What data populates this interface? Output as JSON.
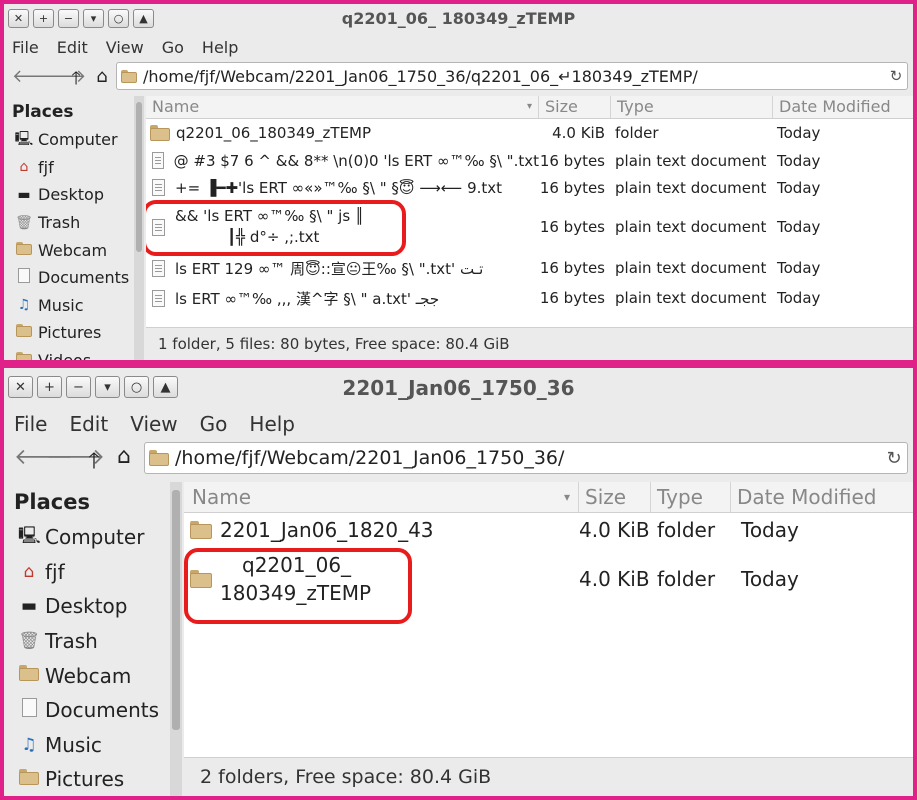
{
  "window1": {
    "title": "q2201_06_ 180349_zTEMP",
    "window_buttons": [
      "✕",
      "+",
      "−",
      "▾",
      "○",
      "▲"
    ],
    "menu": [
      "File",
      "Edit",
      "View",
      "Go",
      "Help"
    ],
    "path": "/home/fjf/Webcam/2201_Jan06_1750_36/q2201_06_↵180349_zTEMP/",
    "sidebar": {
      "heading": "Places",
      "items": [
        "Computer",
        "fjf",
        "Desktop",
        "Trash",
        "Webcam",
        "Documents",
        "Music",
        "Pictures",
        "Videos"
      ]
    },
    "columns": {
      "name": "Name",
      "size": "Size",
      "type": "Type",
      "modified": "Date Modified"
    },
    "rows": [
      {
        "name": "q2201_06_180349_zTEMP",
        "size": "4.0 KiB",
        "type": "folder",
        "modified": "Today",
        "icon": "folder-icon"
      },
      {
        "name": "@ #3 $7 6 ^ && 8** \\n(0)0 'ls ERT ∞™‰ §\\ \".txt",
        "size": "16 bytes",
        "type": "plain text document",
        "modified": "Today",
        "icon": "document-icon"
      },
      {
        "name": "+= ▐━✚'ls ERT ∞«»™‰ §\\ \" §😇 ⟶⟵ 9.txt",
        "size": "16 bytes",
        "type": "plain text document",
        "modified": "Today",
        "icon": "document-icon"
      },
      {
        "name": "&& 'ls ERT ∞™‰ §\\ \" js ║",
        "name_line2": "┃╬ d°÷ ,;.txt",
        "size": "16 bytes",
        "type": "plain text document",
        "modified": "Today",
        "icon": "document-icon"
      },
      {
        "name": "ls ERT 129 ∞™ 周😇::宣😐王‰ §\\ \".txt' تـت",
        "size": "16 bytes",
        "type": "plain text document",
        "modified": "Today",
        "icon": "document-icon"
      },
      {
        "name": "ls ERT ∞™‰ ,,, 漢^字 §\\ \" a.txt' ججـ",
        "size": "16 bytes",
        "type": "plain text document",
        "modified": "Today",
        "icon": "document-icon"
      }
    ],
    "status": "1 folder, 5 files: 80 bytes, Free space: 80.4 GiB"
  },
  "window2": {
    "title": "2201_Jan06_1750_36",
    "window_buttons": [
      "✕",
      "+",
      "−",
      "▾",
      "○",
      "▲"
    ],
    "menu": [
      "File",
      "Edit",
      "View",
      "Go",
      "Help"
    ],
    "path": "/home/fjf/Webcam/2201_Jan06_1750_36/",
    "sidebar": {
      "heading": "Places",
      "items": [
        "Computer",
        "fjf",
        "Desktop",
        "Trash",
        "Webcam",
        "Documents",
        "Music",
        "Pictures"
      ]
    },
    "columns": {
      "name": "Name",
      "size": "Size",
      "type": "Type",
      "modified": "Date Modified"
    },
    "rows": [
      {
        "name": "2201_Jan06_1820_43",
        "size": "4.0 KiB",
        "type": "folder",
        "modified": "Today",
        "icon": "folder-icon"
      },
      {
        "name": "q2201_06_",
        "name_line2": "180349_zTEMP",
        "size": "4.0 KiB",
        "type": "folder",
        "modified": "Today",
        "icon": "folder-icon"
      }
    ],
    "status": "2 folders, Free space: 80.4 GiB"
  },
  "colors": {
    "frame": "#e0218a",
    "highlight": "#e81c1c",
    "window_bg": "#ebebeb"
  },
  "icons": {
    "back": "arrow-left-icon",
    "forward": "arrow-right-icon",
    "up": "arrow-up-icon",
    "home": "home-icon",
    "reload": "reload-icon"
  }
}
